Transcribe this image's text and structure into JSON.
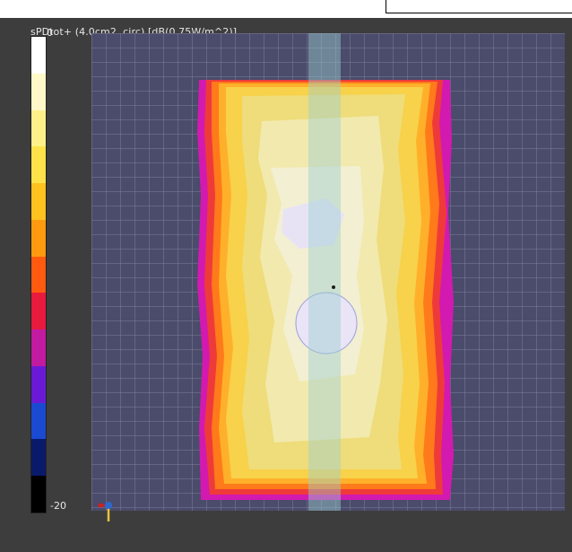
{
  "title": "sPDtot+ (4.0cm2, circ) [dB(0.75W/m^2)]",
  "colorbar": {
    "max_label": "0",
    "min_label": "-20",
    "colors": [
      "#ffffff",
      "#fff8c8",
      "#fff08a",
      "#ffe24a",
      "#ffc21e",
      "#ff9a10",
      "#ff5a10",
      "#e81a3e",
      "#c21aa0",
      "#6a1ad6",
      "#1a4ad2",
      "#0a1a6a",
      "#000000"
    ]
  },
  "view": {
    "background_color": "#3d3d3d",
    "plot_color": "#4b4b6b"
  }
}
